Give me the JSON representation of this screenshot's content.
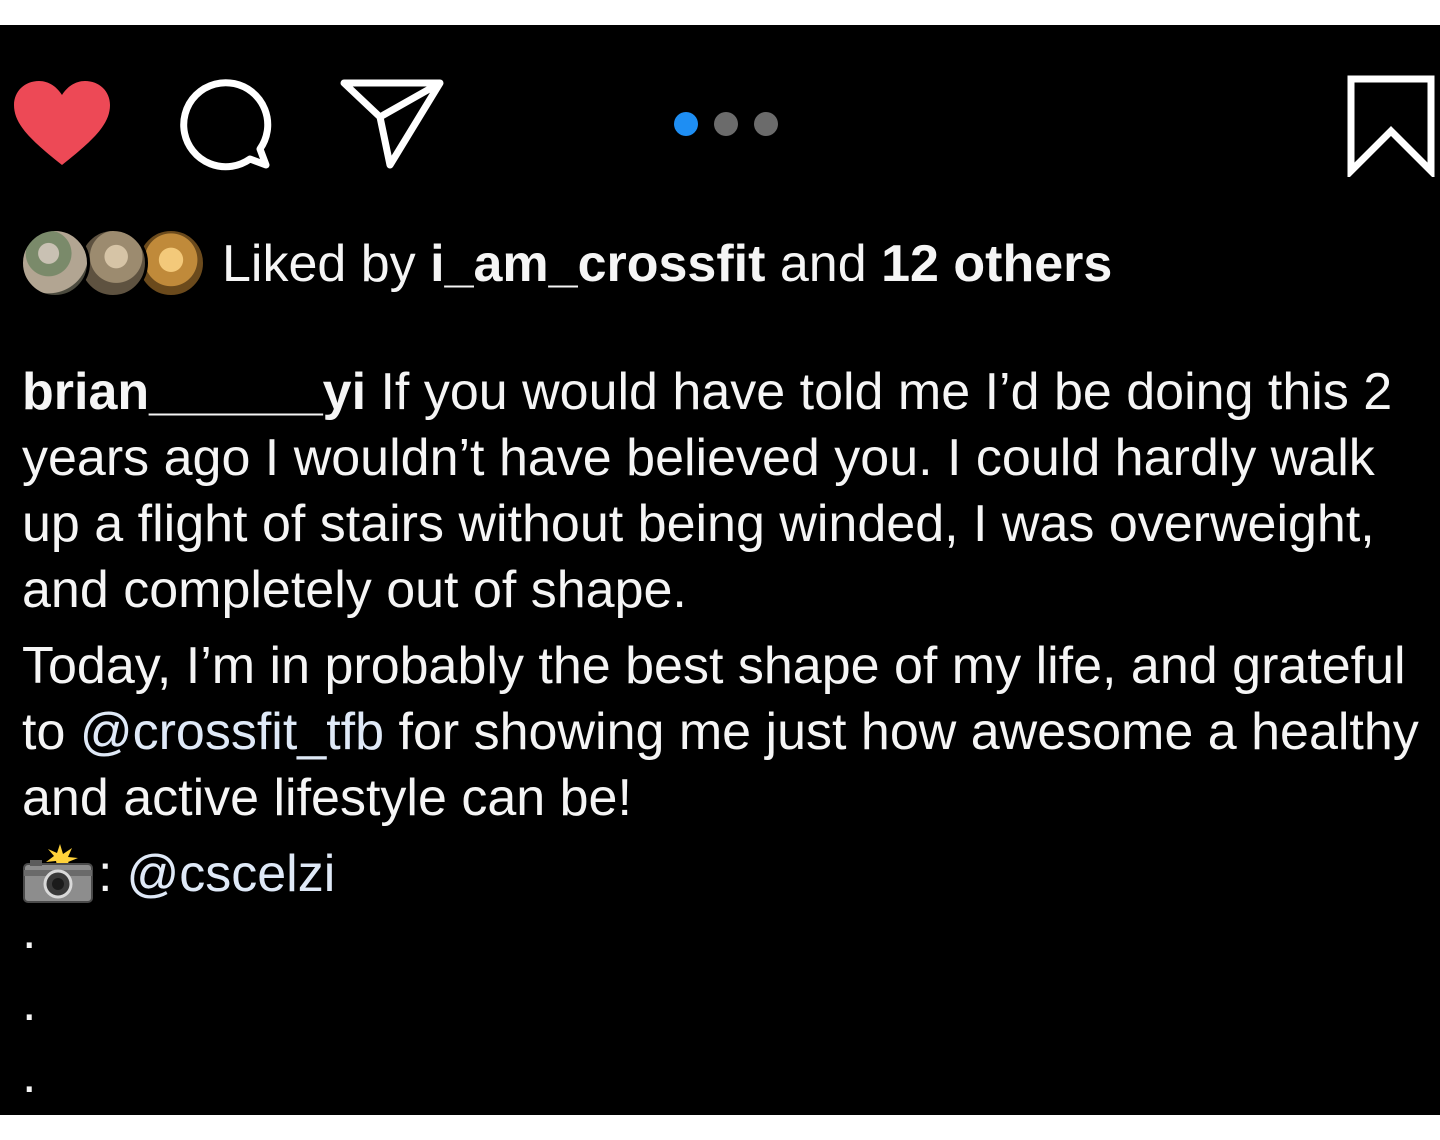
{
  "actions": {
    "like_icon": "heart-filled-icon",
    "like_color": "#ed4956",
    "comment_icon": "comment-icon",
    "share_icon": "send-icon",
    "save_icon": "bookmark-icon"
  },
  "carousel": {
    "count": 3,
    "active_index": 0,
    "active_color": "#1e8ef3"
  },
  "likes": {
    "prefix": "Liked by ",
    "user": "i_am_crossfit",
    "middle": " and ",
    "others": "12 others"
  },
  "caption": {
    "username": "brian______yi",
    "text1": " If you would have told me I’d be doing this 2 years ago I wouldn’t have believed you. I could hardly walk up a flight of stairs without being winded, I was overweight, and completely out of shape.",
    "text2_before": "Today, I’m in probably the best shape of my life, and grateful to ",
    "mention": "@crossfit_tfb",
    "text2_after": " for showing me just how awesome a healthy and active lifestyle can be!",
    "credit_icon": "camera-flash-icon",
    "credit_colon": ":",
    "credit_mention": "@cscelzi",
    "dots": [
      ".",
      ".",
      "."
    ]
  }
}
